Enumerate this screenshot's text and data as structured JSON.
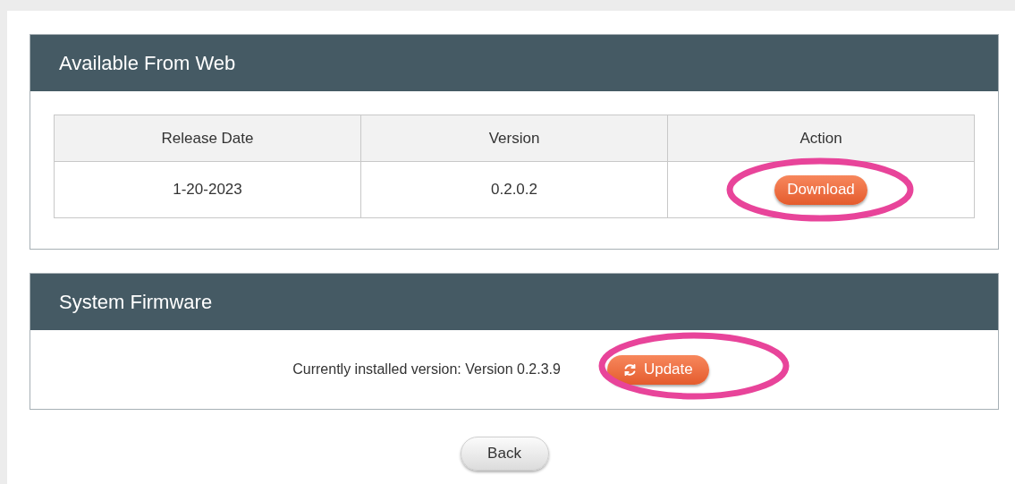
{
  "web_panel": {
    "title": "Available From Web",
    "table": {
      "columns": [
        "Release Date",
        "Version",
        "Action"
      ],
      "rows": [
        {
          "release_date": "1-20-2023",
          "version": "0.2.0.2",
          "action": "Download"
        }
      ]
    }
  },
  "firmware_panel": {
    "title": "System Firmware",
    "installed_text": "Currently installed version: Version 0.2.3.9",
    "update_button": "Update"
  },
  "back_button": "Back"
}
